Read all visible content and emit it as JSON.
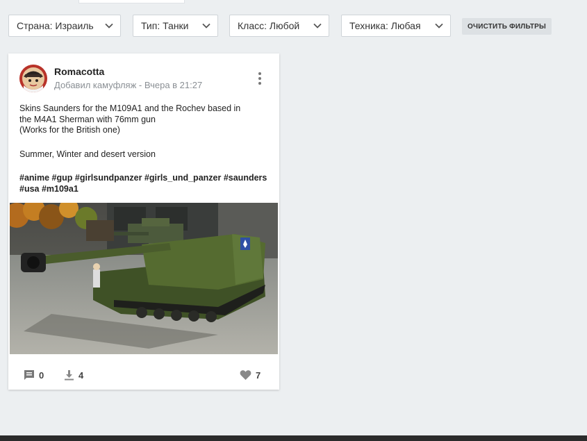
{
  "filters": [
    {
      "label": "Страна: Израиль"
    },
    {
      "label": "Тип: Танки"
    },
    {
      "label": "Класс: Любой"
    },
    {
      "label": "Техника: Любая"
    }
  ],
  "clear_filters_label": "ОЧИСТИТЬ ФИЛЬТРЫ",
  "post": {
    "author": "Romacotta",
    "meta": "Добавил камуфляж - Вчера в 21:27",
    "description_lines": [
      "Skins Saunders for the M109A1 and the Rochev based in",
      "the M4A1 Sherman with 76mm gun",
      "(Works for the British one)"
    ],
    "description_extra": "Summer, Winter and desert version",
    "tags_line1": "#anime #gup #girlsundpanzer #girls_und_panzer #saunders",
    "tags_line2": "#usa #m109a1",
    "comments": "0",
    "downloads": "4",
    "likes": "7"
  },
  "icons": {
    "filter_chevron": "chevron-down-icon",
    "menu": "kebab-menu-icon",
    "comments": "comment-icon",
    "downloads": "download-icon",
    "likes": "heart-icon"
  }
}
